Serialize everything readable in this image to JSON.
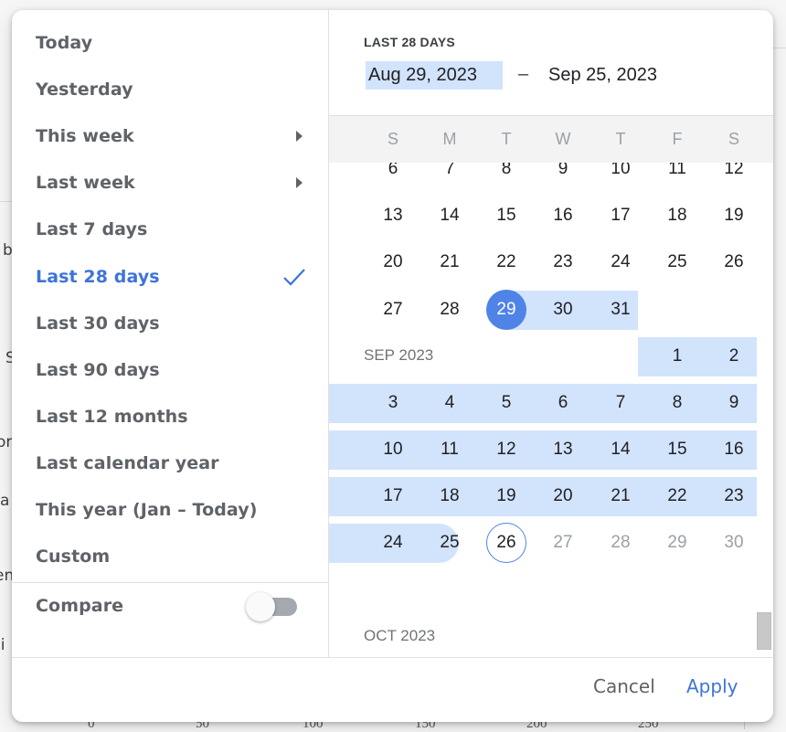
{
  "background": {
    "fragments": [
      "b",
      "S",
      "or",
      "a",
      "en",
      "li"
    ],
    "axis_ticks": [
      "0",
      "50",
      "100",
      "150",
      "200",
      "250"
    ]
  },
  "presets": [
    {
      "label": "Today",
      "submenu": false,
      "active": false
    },
    {
      "label": "Yesterday",
      "submenu": false,
      "active": false
    },
    {
      "label": "This week",
      "submenu": true,
      "active": false
    },
    {
      "label": "Last week",
      "submenu": true,
      "active": false
    },
    {
      "label": "Last 7 days",
      "submenu": false,
      "active": false
    },
    {
      "label": "Last 28 days",
      "submenu": false,
      "active": true
    },
    {
      "label": "Last 30 days",
      "submenu": false,
      "active": false
    },
    {
      "label": "Last 90 days",
      "submenu": false,
      "active": false
    },
    {
      "label": "Last 12 months",
      "submenu": false,
      "active": false
    },
    {
      "label": "Last calendar year",
      "submenu": false,
      "active": false
    },
    {
      "label": "This year (Jan – Today)",
      "submenu": false,
      "active": false
    },
    {
      "label": "Custom",
      "submenu": false,
      "active": false
    }
  ],
  "compare": {
    "label": "Compare",
    "enabled": false
  },
  "range": {
    "label": "LAST 28 DAYS",
    "start": "Aug 29, 2023",
    "separator": "–",
    "end": "Sep 25, 2023"
  },
  "weekdays": [
    "S",
    "M",
    "T",
    "W",
    "T",
    "F",
    "S"
  ],
  "calendar": {
    "partial_row": [
      "6",
      "7",
      "8",
      "9",
      "10",
      "11",
      "12"
    ],
    "aug_rows": [
      [
        "13",
        "14",
        "15",
        "16",
        "17",
        "18",
        "19"
      ],
      [
        "20",
        "21",
        "22",
        "23",
        "24",
        "25",
        "26"
      ],
      [
        "27",
        "28",
        "29",
        "30",
        "31",
        "",
        ""
      ]
    ],
    "sep_label": "SEP 2023",
    "sep_first_row": [
      "",
      "",
      "",
      "",
      "",
      "1",
      "2"
    ],
    "sep_rows": [
      [
        "3",
        "4",
        "5",
        "6",
        "7",
        "8",
        "9"
      ],
      [
        "10",
        "11",
        "12",
        "13",
        "14",
        "15",
        "16"
      ],
      [
        "17",
        "18",
        "19",
        "20",
        "21",
        "22",
        "23"
      ],
      [
        "24",
        "25",
        "26",
        "27",
        "28",
        "29",
        "30"
      ]
    ],
    "oct_label": "OCT 2023",
    "selected_start": "Aug 29",
    "selected_end": "Sep 25",
    "today": "Sep 26"
  },
  "colors": {
    "accent": "#4f83e6",
    "range_fill": "#d2e3fc",
    "active_text": "#3d74d9"
  },
  "footer": {
    "cancel_label": "Cancel",
    "apply_label": "Apply"
  }
}
